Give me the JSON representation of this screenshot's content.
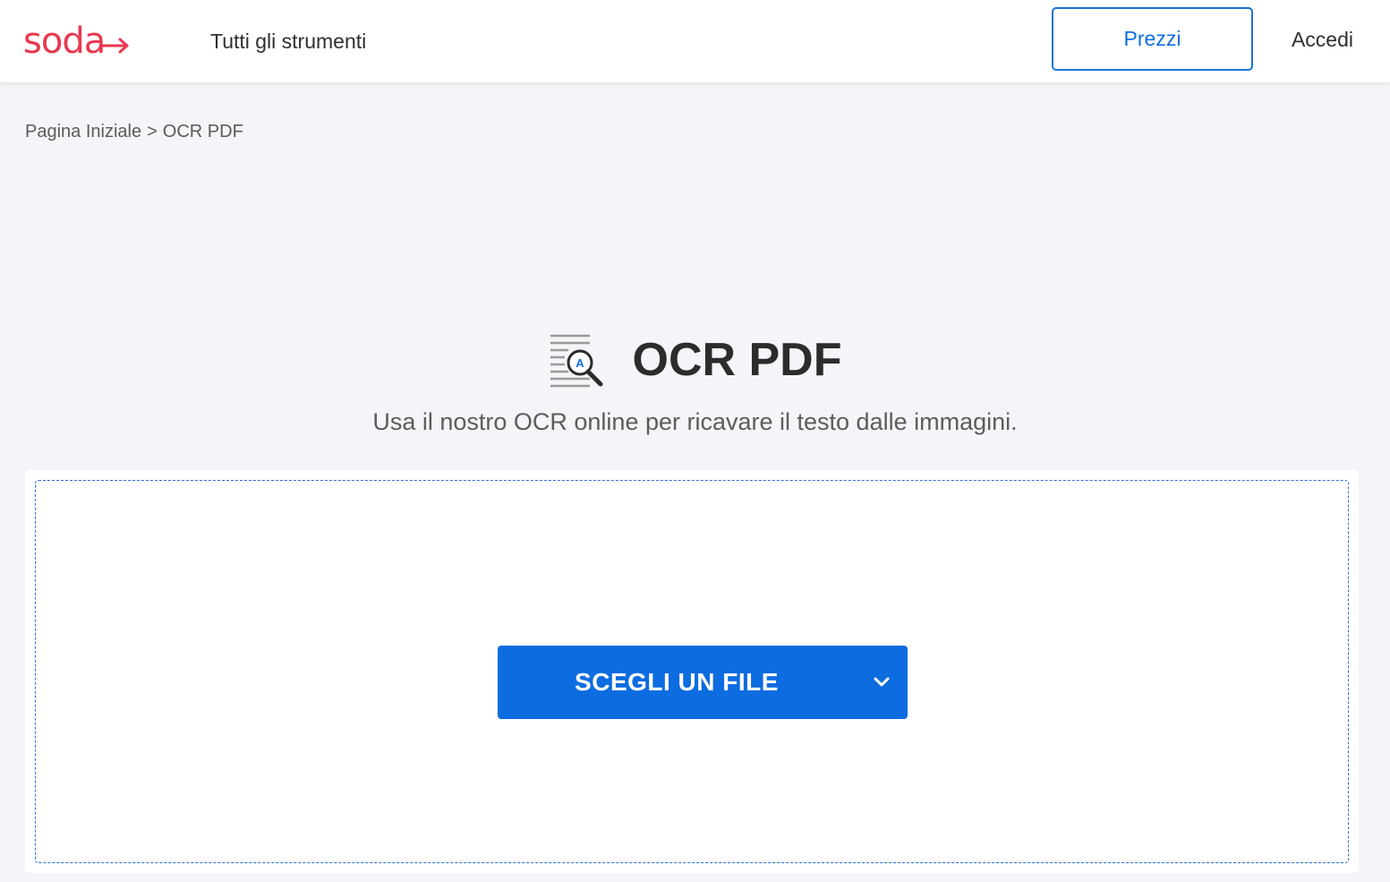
{
  "header": {
    "logo_text": "soda",
    "logo_color": "#e8384f",
    "nav_tools_label": "Tutti gli strumenti",
    "pricing_label": "Prezzi",
    "login_label": "Accedi"
  },
  "breadcrumb": {
    "home_label": "Pagina Iniziale",
    "separator": ">",
    "current_label": "OCR PDF"
  },
  "hero": {
    "icon": "ocr-magnifier-icon",
    "title": "OCR PDF",
    "subtitle": "Usa il nostro OCR online per ricavare il testo dalle immagini.",
    "icon_letter": "A"
  },
  "upload": {
    "choose_file_label": "SCEGLI UN FILE",
    "dropdown_icon": "chevron-down-icon"
  },
  "colors": {
    "accent": "#0d6ce0",
    "background": "#f4f5f8",
    "dropzone_border": "#2a6dd6"
  }
}
